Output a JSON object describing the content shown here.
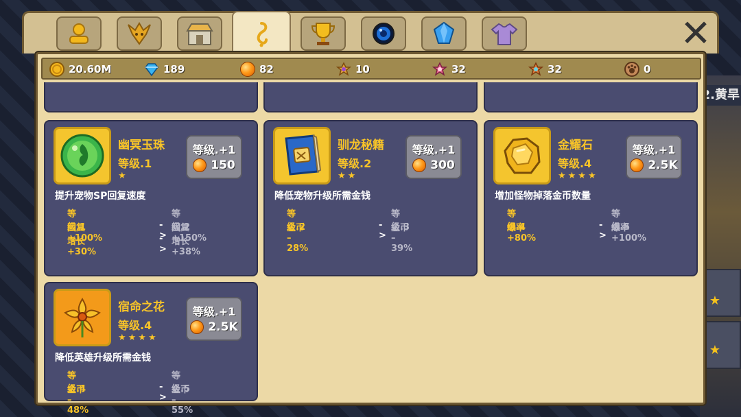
{
  "tabs": [
    {
      "name": "profile-tab-icon",
      "color": "#f0b81a"
    },
    {
      "name": "dragon-tab-icon",
      "color": "#d89a1a"
    },
    {
      "name": "shop-tab-icon",
      "color": "#b0b0b0"
    },
    {
      "name": "pet-relic-tab-icon",
      "color": "#f0b81a",
      "active": true
    },
    {
      "name": "trophy-tab-icon",
      "color": "#f0b81a"
    },
    {
      "name": "portal-tab-icon",
      "color": "#1e6fd6"
    },
    {
      "name": "crystal-tab-icon",
      "color": "#3aa0f0"
    },
    {
      "name": "outfit-tab-icon",
      "color": "#9b7ac8"
    }
  ],
  "currency": {
    "gold": "20.60M",
    "diamond": "189",
    "orb": "82",
    "dragon_shard": "10",
    "pink_shard": "32",
    "fox_shard": "32",
    "paw_token": "0"
  },
  "background": {
    "right_label": "2.黄旱"
  },
  "cards": [
    {
      "name": "幽冥玉珠",
      "level": "等级.1",
      "stars": "★",
      "upgrade_label": "等级.+1",
      "cost": "150",
      "desc": "提升宠物SP回复速度",
      "current": [
        "等级.1",
        "回复 +100%",
        "增长 +30%"
      ],
      "next": [
        "等级.2",
        "回复 +150%",
        "增长 +38%"
      ]
    },
    {
      "name": "驯龙秘籍",
      "level": "等级.2",
      "stars": "★★",
      "upgrade_label": "等级.+1",
      "cost": "300",
      "desc": "降低宠物升级所需金钱",
      "current": [
        "等级.2",
        "金币 –28%"
      ],
      "next": [
        "等级.3",
        "金币 –39%"
      ]
    },
    {
      "name": "金耀石",
      "level": "等级.4",
      "stars": "★★★★",
      "upgrade_label": "等级.+1",
      "cost": "2.5K",
      "desc": "增加怪物掉落金币数量",
      "current": [
        "等级.4",
        "爆率 +80%"
      ],
      "next": [
        "等级.5",
        "爆率 +100%"
      ]
    },
    {
      "name": "宿命之花",
      "level": "等级.4",
      "stars": "★★★★",
      "upgrade_label": "等级.+1",
      "cost": "2.5K",
      "desc": "降低英雄升级所需金钱",
      "current": [
        "等级.4",
        "金币 –48%"
      ],
      "next": [
        "等级.5",
        "金币 –55%"
      ]
    }
  ],
  "arrow": "->",
  "close_label": "✕"
}
